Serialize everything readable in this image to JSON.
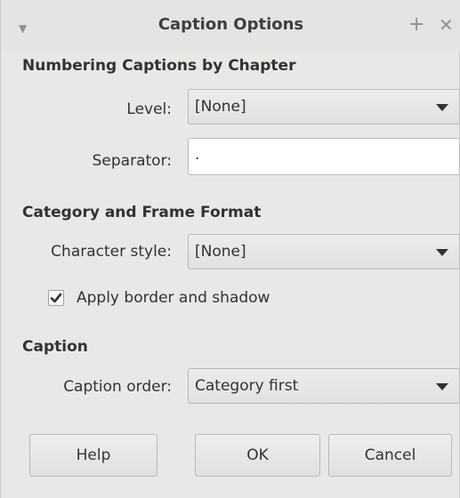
{
  "window": {
    "title": "Caption Options"
  },
  "numbering": {
    "heading": "Numbering Captions by Chapter",
    "level_label": "Level:",
    "level_value": "[None]",
    "separator_label": "Separator:",
    "separator_value": "."
  },
  "category": {
    "heading": "Category and Frame Format",
    "char_style_label": "Character style:",
    "char_style_value": "[None]",
    "apply_border_label": "Apply border and shadow",
    "apply_border_checked": true
  },
  "caption": {
    "heading": "Caption",
    "order_label": "Caption order:",
    "order_value": "Category first"
  },
  "buttons": {
    "help": "Help",
    "ok": "OK",
    "cancel": "Cancel"
  }
}
